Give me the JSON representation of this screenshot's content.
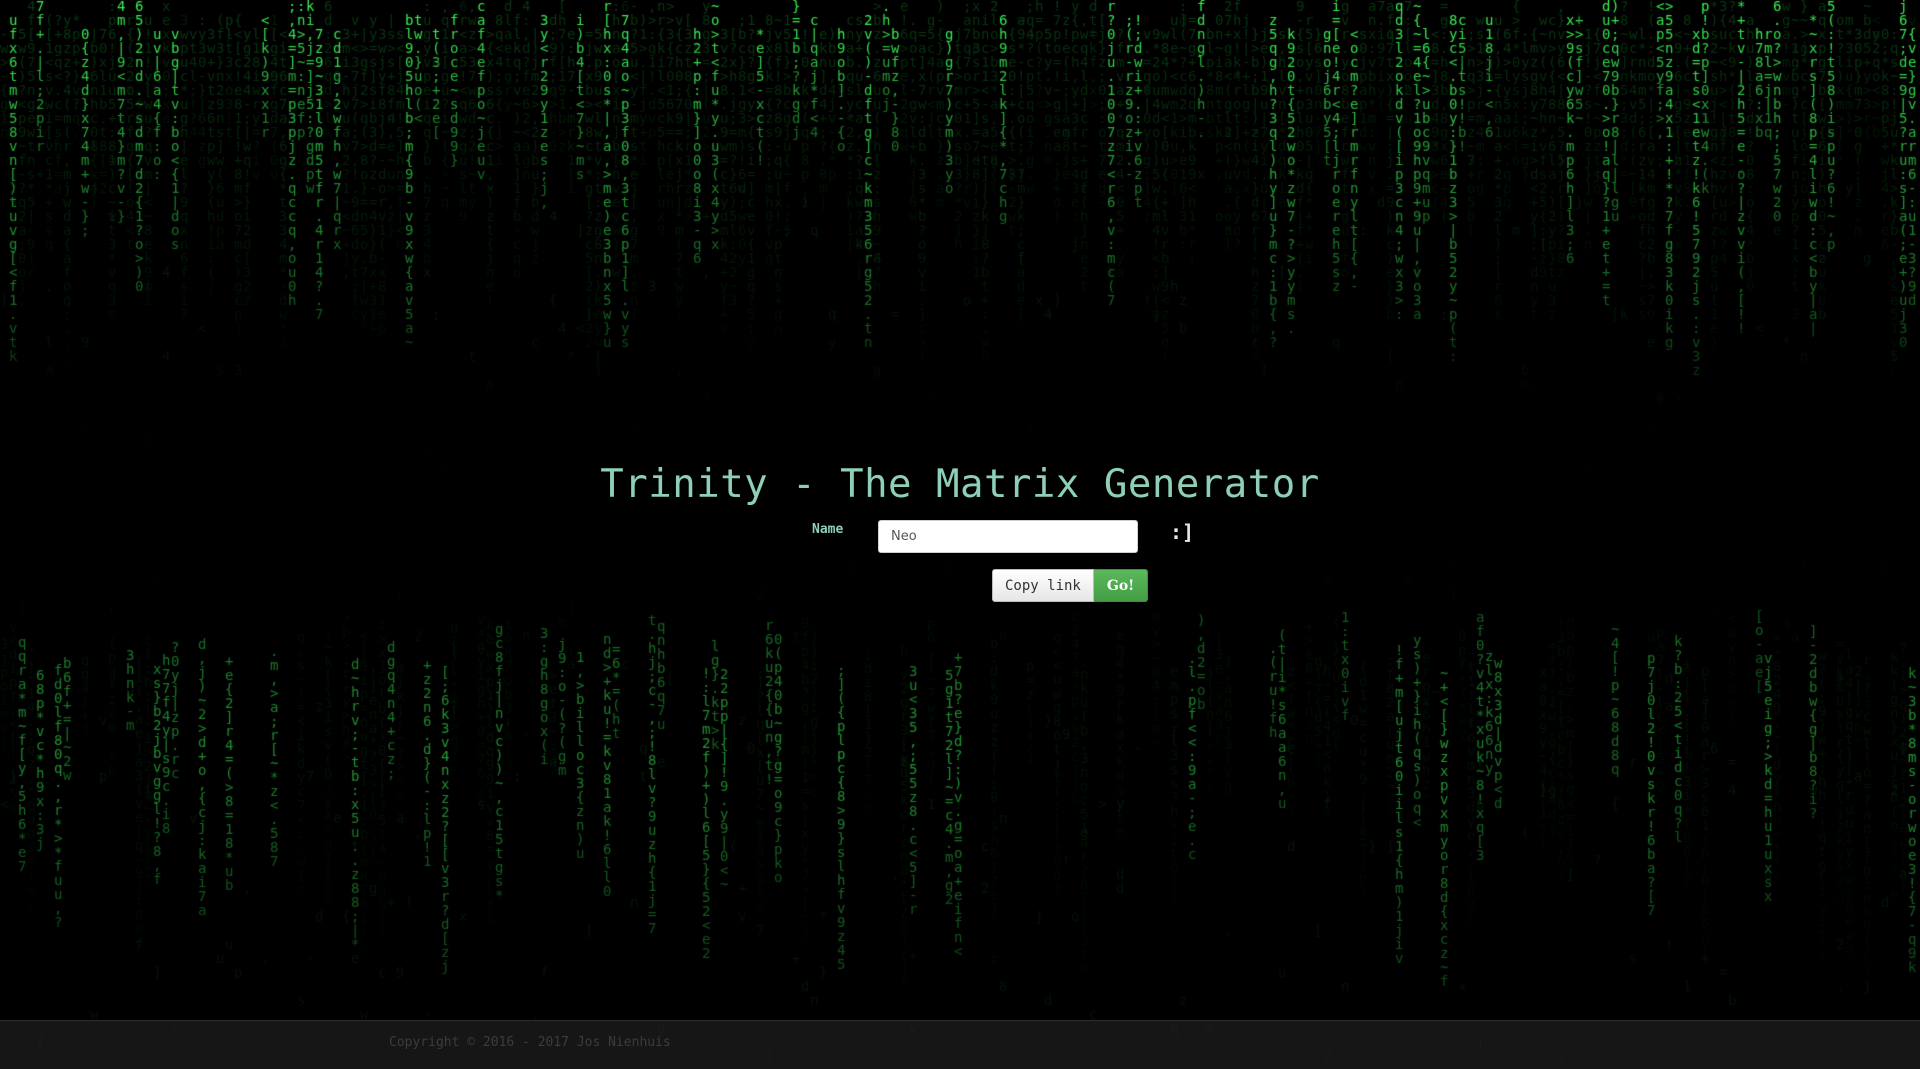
{
  "page": {
    "title": "Trinity - The Matrix Generator"
  },
  "form": {
    "name_label": "Name",
    "name_value": "Neo",
    "smiley": ":]",
    "copy_link_label": "Copy link",
    "go_label": "Go!"
  },
  "footer": {
    "copyright": "Copyright © 2016 - 2017 Jos Nienhuis"
  },
  "theme": {
    "background": "#000000",
    "rain_bright": "#3cff5a",
    "rain_mid": "#1f9a34",
    "rain_dim": "#0c3a16",
    "title_color": "#8ed0b6",
    "go_button": "#5cb85c"
  },
  "background_effect": {
    "type": "matrix-digital-rain",
    "glyphs": "abcdefghijklmnopqrstuvwxyz0123456789{}()[]<>~|-=+*:;.,!?"
  }
}
